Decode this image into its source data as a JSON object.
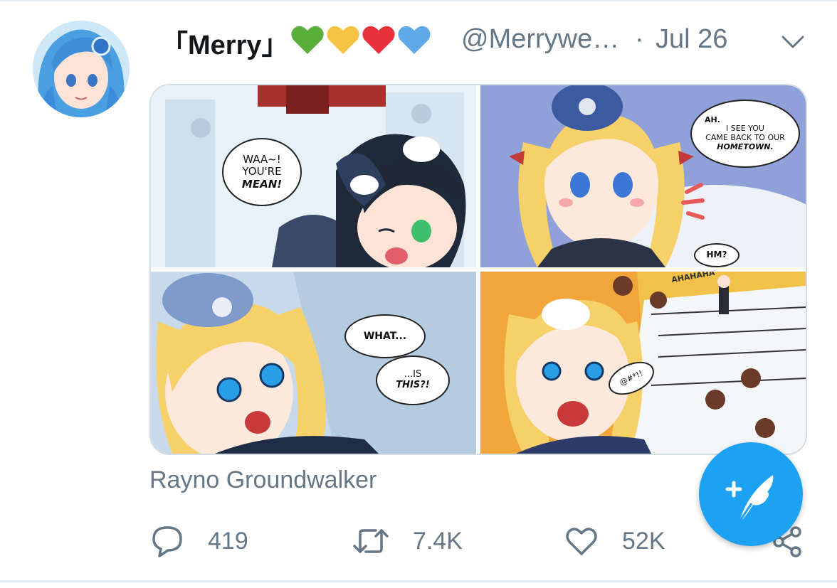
{
  "tweet": {
    "display_name": "「Merry」",
    "hearts": [
      "green-heart",
      "yellow-heart",
      "red-heart",
      "blue-heart"
    ],
    "heart_colors": [
      "#5aae3c",
      "#f6c445",
      "#e8323c",
      "#5ea9e6"
    ],
    "handle": "@Merrywe…",
    "separator": "·",
    "date": "Jul 26",
    "caption": "Rayno Groundwalker"
  },
  "media": {
    "panel_1": {
      "bubble": [
        "WAA~!",
        "YOU'RE",
        "MEAN!"
      ]
    },
    "panel_2": {
      "bubble_top": [
        "AH.",
        "I SEE YOU",
        "CAME BACK TO OUR",
        "HOMETOWN."
      ],
      "bubble_bottom": "HM?"
    },
    "panel_3": {
      "bubble_top": "WHAT...",
      "bubble_bottom": [
        "...IS",
        "THIS?!"
      ]
    },
    "panel_4": {
      "sfx_top": "AHAHAHA",
      "sfx_mid": "@#*!!"
    }
  },
  "actions": {
    "reply_count": "419",
    "retweet_count": "7.4K",
    "like_count": "52K"
  },
  "colors": {
    "accent": "#1da1f2",
    "secondary_text": "#657786",
    "divider": "#e6ecf0"
  }
}
